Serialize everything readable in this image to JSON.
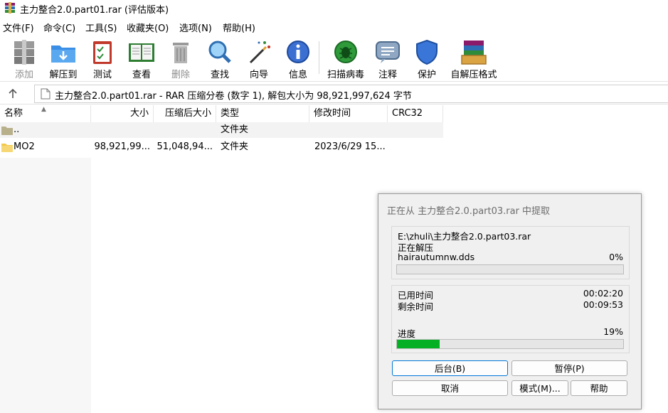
{
  "window": {
    "title": "主力整合2.0.part01.rar (评估版本)"
  },
  "menu": [
    {
      "label": "文件(F)"
    },
    {
      "label": "命令(C)"
    },
    {
      "label": "工具(S)"
    },
    {
      "label": "收藏夹(O)"
    },
    {
      "label": "选项(N)"
    },
    {
      "label": "帮助(H)"
    }
  ],
  "toolbar": [
    {
      "label": "添加",
      "icon": "archive-stack-icon",
      "enabled": false
    },
    {
      "label": "解压到",
      "icon": "extract-folder-icon",
      "enabled": true
    },
    {
      "label": "测试",
      "icon": "test-clipboard-icon",
      "enabled": true
    },
    {
      "label": "查看",
      "icon": "view-book-icon",
      "enabled": true
    },
    {
      "label": "删除",
      "icon": "trash-can-icon",
      "enabled": false
    },
    {
      "label": "查找",
      "icon": "magnifier-icon",
      "enabled": true
    },
    {
      "label": "向导",
      "icon": "wizard-wand-icon",
      "enabled": true
    },
    {
      "label": "信息",
      "icon": "info-icon",
      "enabled": true
    },
    {
      "label": "扫描病毒",
      "icon": "virus-scan-icon",
      "enabled": true
    },
    {
      "label": "注释",
      "icon": "comment-icon",
      "enabled": true
    },
    {
      "label": "保护",
      "icon": "shield-icon",
      "enabled": true
    },
    {
      "label": "自解压格式",
      "icon": "sfx-box-icon",
      "enabled": true
    }
  ],
  "address": {
    "text": "主力整合2.0.part01.rar - RAR 压缩分卷 (数字 1), 解包大小为 98,921,997,624 字节"
  },
  "columns": [
    "名称",
    "大小",
    "压缩后大小",
    "类型",
    "修改时间",
    "CRC32"
  ],
  "files": [
    {
      "name": "..",
      "size": "",
      "packed": "",
      "type": "文件夹",
      "modified": "",
      "crc": ""
    },
    {
      "name": "MO2",
      "size": "98,921,99...",
      "packed": "51,048,94...",
      "type": "文件夹",
      "modified": "2023/6/29 15...",
      "crc": ""
    }
  ],
  "dialog": {
    "title": "正在从 主力整合2.0.part03.rar 中提取",
    "archive_path": "E:\\zhuli\\主力整合2.0.part03.rar",
    "status": "正在解压",
    "current_file": "hairautumnw.dds",
    "file_percent_text": "0%",
    "file_progress": 0.0,
    "elapsed_label": "已用时间",
    "elapsed_value": "00:02:20",
    "remaining_label": "剩余时间",
    "remaining_value": "00:09:53",
    "progress_label": "进度",
    "progress_text": "19%",
    "progress": 0.19,
    "buttons": {
      "background": "后台(B)",
      "pause": "暂停(P)",
      "cancel": "取消",
      "mode": "模式(M)...",
      "help": "帮助"
    }
  },
  "colors": {
    "progress_fill": "#06b025",
    "default_button_border": "#0078d7"
  }
}
